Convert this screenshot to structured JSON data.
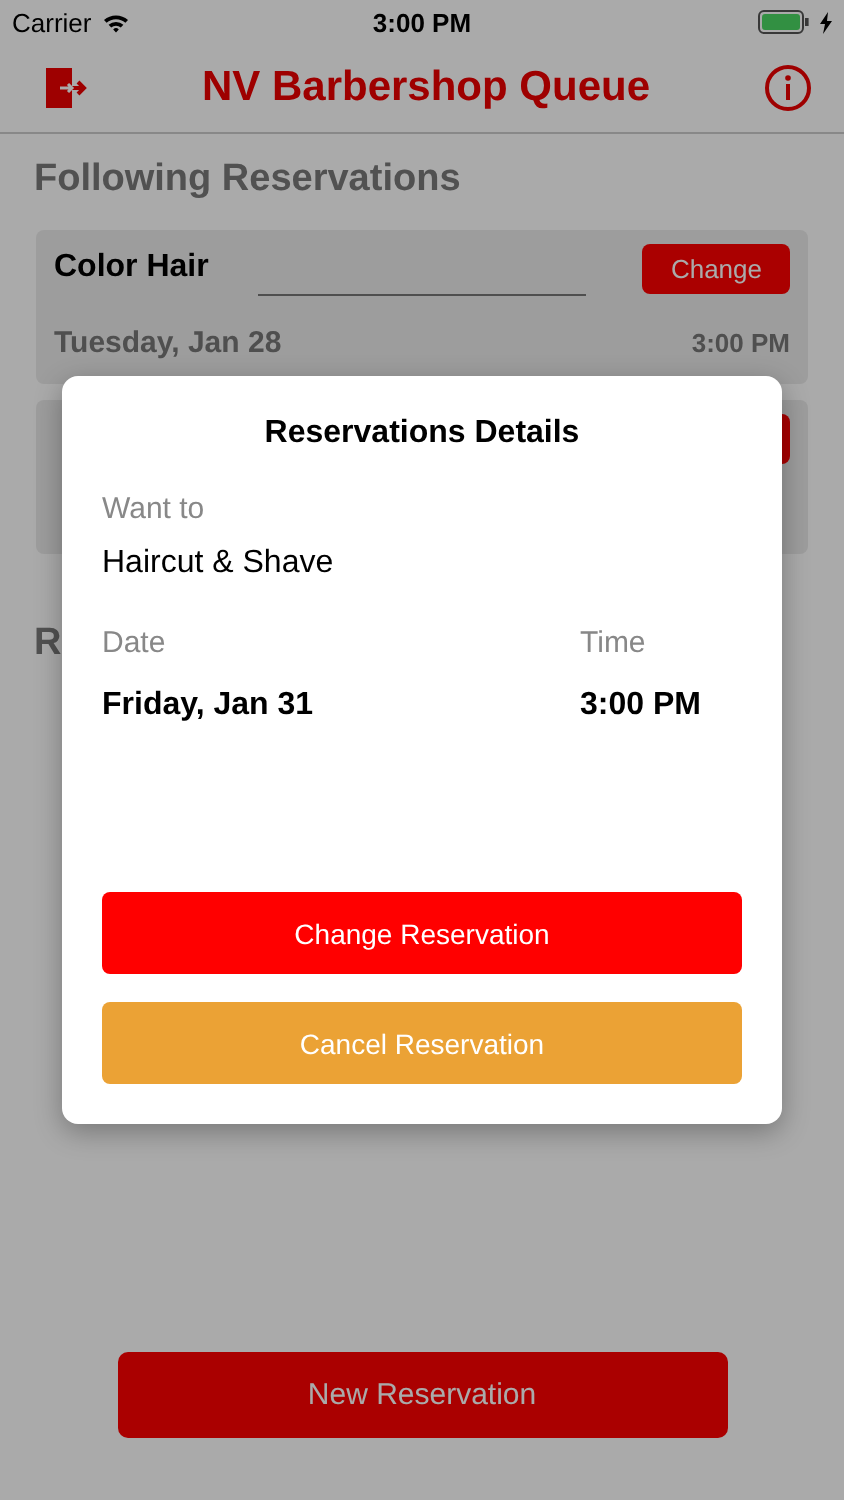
{
  "status_bar": {
    "carrier": "Carrier",
    "time": "3:00 PM",
    "charging": true
  },
  "nav": {
    "title": "NV Barbershop Queue"
  },
  "following": {
    "title": "Following Reservations",
    "reservations": [
      {
        "kind": "booking",
        "service": "Color Hair",
        "date": "Tuesday, Jan 28",
        "time": "3:00 PM",
        "button": "Change"
      },
      {
        "kind": "covered"
      }
    ]
  },
  "next_section": {
    "title": "R"
  },
  "new_button": "New Reservation",
  "modal": {
    "title": "Reservations Details",
    "want_label": "Want to",
    "want_value": "Haircut & Shave",
    "date_label": "Date",
    "date_value": "Friday, Jan 31",
    "time_label": "Time",
    "time_value": "3:00 PM",
    "buttons": [
      {
        "label": "Change Reservation",
        "kind": "change"
      },
      {
        "label": "Cancel Reservation",
        "kind": "cancel"
      }
    ]
  }
}
